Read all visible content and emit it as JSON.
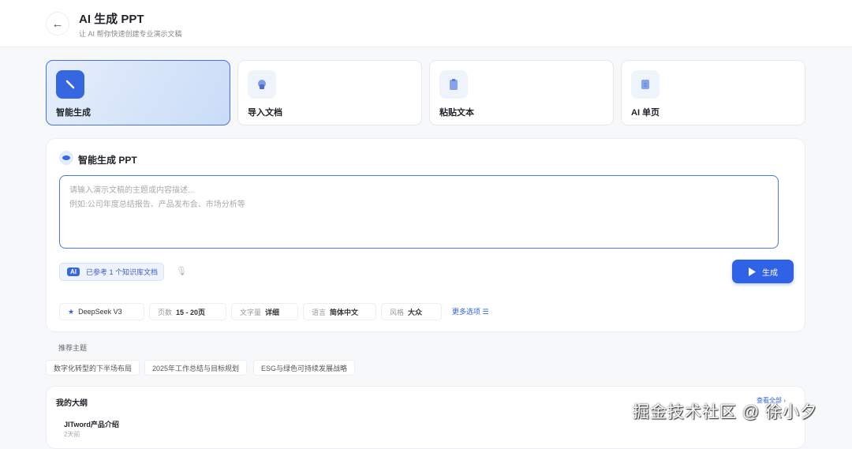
{
  "header": {
    "title": "AI 生成 PPT",
    "subtitle": "让 AI 帮你快速创建专业演示文稿"
  },
  "modes": [
    {
      "label": "智能生成",
      "icon": "magic-wand-icon"
    },
    {
      "label": "导入文档",
      "icon": "cloud-upload-icon"
    },
    {
      "label": "粘贴文本",
      "icon": "clipboard-icon"
    },
    {
      "label": "AI 单页",
      "icon": "page-icon"
    }
  ],
  "panel": {
    "title": "智能生成 PPT",
    "placeholder_line1": "请输入演示文稿的主题或内容描述...",
    "placeholder_line2": "例如:公司年度总结报告、产品发布会、市场分析等",
    "ai_badge": "AI",
    "kb_ref": "已参考 1 个知识库文档",
    "generate": "生成",
    "options": [
      {
        "key": "",
        "value": "DeepSeek V3"
      },
      {
        "key": "页数",
        "value": "15 - 20页"
      },
      {
        "key": "文字量",
        "value": "详细"
      },
      {
        "key": "语言",
        "value": "简体中文"
      },
      {
        "key": "风格",
        "value": "大众"
      }
    ],
    "more": "更多选项"
  },
  "topics": {
    "title": "推荐主题",
    "items": [
      "数字化转型的下半场布局",
      "2025年工作总结与目标规划",
      "ESG与绿色可持续发展战略"
    ]
  },
  "outline": {
    "title": "我的大纲",
    "view_all": "查看全部",
    "items": [
      {
        "name": "JITword产品介绍",
        "time": "2天前"
      }
    ]
  },
  "watermark": "掘金技术社区 @ 徐小夕",
  "colors": {
    "accent": "#2f62e6"
  }
}
